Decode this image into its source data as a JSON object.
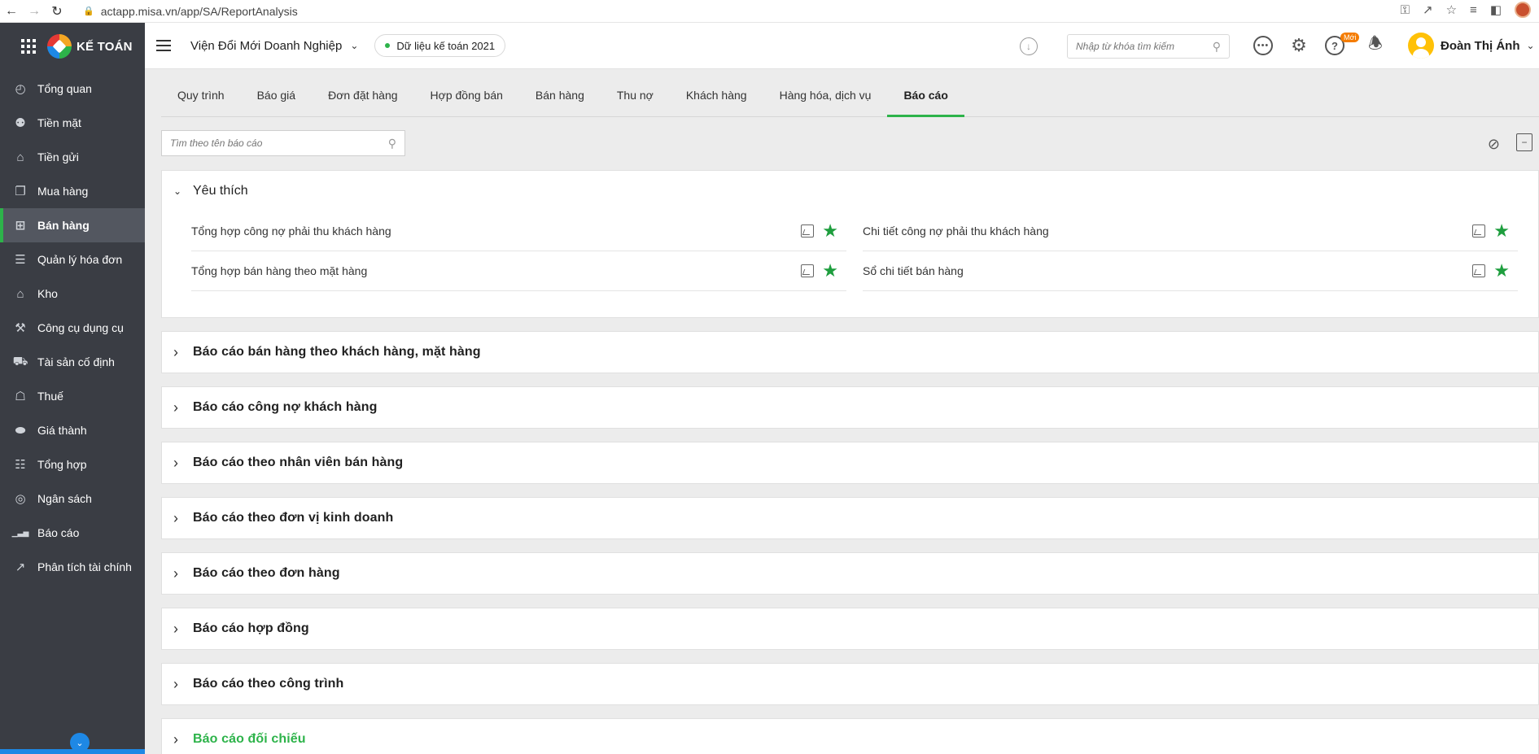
{
  "browser": {
    "url": "actapp.misa.vn/app/SA/ReportAnalysis"
  },
  "sidebar": {
    "brand": "KẾ TOÁN",
    "items": [
      {
        "label": "Tổng quan",
        "icon": "dashboard-icon"
      },
      {
        "label": "Tiền mặt",
        "icon": "cash-bag-icon"
      },
      {
        "label": "Tiền gửi",
        "icon": "bank-icon"
      },
      {
        "label": "Mua hàng",
        "icon": "purchase-icon"
      },
      {
        "label": "Bán hàng",
        "icon": "cart-icon",
        "active": true
      },
      {
        "label": "Quản lý hóa đơn",
        "icon": "invoice-icon"
      },
      {
        "label": "Kho",
        "icon": "warehouse-icon"
      },
      {
        "label": "Công cụ dụng cụ",
        "icon": "tools-icon"
      },
      {
        "label": "Tài sản cố định",
        "icon": "car-icon"
      },
      {
        "label": "Thuế",
        "icon": "tax-icon"
      },
      {
        "label": "Giá thành",
        "icon": "price-tag-icon"
      },
      {
        "label": "Tổng hợp",
        "icon": "summary-icon"
      },
      {
        "label": "Ngân sách",
        "icon": "budget-icon"
      },
      {
        "label": "Báo cáo",
        "icon": "bar-chart-icon"
      },
      {
        "label": "Phân tích tài chính",
        "icon": "line-chart-icon"
      }
    ]
  },
  "header": {
    "org_name": "Viện Đổi Mới Doanh Nghiệp",
    "data_label": "Dữ liệu kế toán 2021",
    "search_placeholder": "Nhập từ khóa tìm kiếm",
    "new_badge": "Mới",
    "user_name": "Đoàn Thị Ánh"
  },
  "tabs": [
    {
      "label": "Quy trình"
    },
    {
      "label": "Báo giá"
    },
    {
      "label": "Đơn đặt hàng"
    },
    {
      "label": "Hợp đồng bán"
    },
    {
      "label": "Bán hàng"
    },
    {
      "label": "Thu nợ"
    },
    {
      "label": "Khách hàng"
    },
    {
      "label": "Hàng hóa, dịch vụ"
    },
    {
      "label": "Báo cáo",
      "active": true
    }
  ],
  "report_search": {
    "placeholder": "Tìm theo tên báo cáo"
  },
  "favorites": {
    "title": "Yêu thích",
    "items": [
      {
        "label": "Tổng hợp công nợ phải thu khách hàng"
      },
      {
        "label": "Chi tiết công nợ phải thu khách hàng"
      },
      {
        "label": "Tổng hợp bán hàng theo mặt hàng"
      },
      {
        "label": "Sổ chi tiết bán hàng"
      }
    ]
  },
  "groups": [
    {
      "label": "Báo cáo bán hàng theo khách hàng, mặt hàng"
    },
    {
      "label": "Báo cáo công nợ khách hàng"
    },
    {
      "label": "Báo cáo theo nhân viên bán hàng"
    },
    {
      "label": "Báo cáo theo đơn vị kinh doanh"
    },
    {
      "label": "Báo cáo theo đơn hàng"
    },
    {
      "label": "Báo cáo hợp đồng"
    },
    {
      "label": "Báo cáo theo công trình"
    },
    {
      "label": "Báo cáo đối chiếu",
      "highlight": true
    }
  ],
  "colors": {
    "accent_green": "#2db34a",
    "sidebar_bg": "#3a3d44",
    "star_green": "#1e9e3e",
    "badge_orange": "#f57c00"
  }
}
